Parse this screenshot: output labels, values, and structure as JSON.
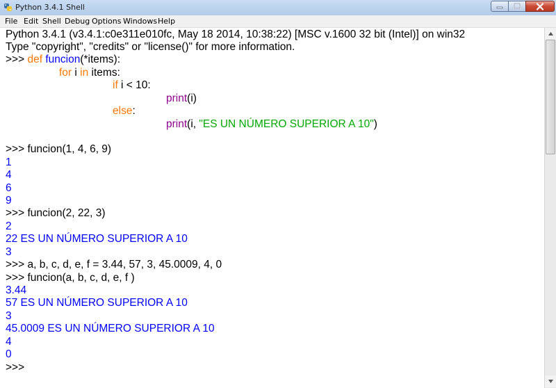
{
  "window": {
    "title": "Python 3.4.1 Shell",
    "app_icon": "python-icon"
  },
  "menu": [
    "File",
    "Edit",
    "Shell",
    "Debug",
    "Options",
    "Windows",
    "Help"
  ],
  "controls": {
    "minimize_icon": "minimize-icon",
    "maximize_icon": "maximize-icon",
    "close_icon": "close-icon"
  },
  "colors": {
    "keyword": "#ff7700",
    "definition": "#0000ff",
    "builtin": "#900090",
    "string": "#00aa00",
    "output": "#0000ff"
  },
  "shell": {
    "banner1": "Python 3.4.1 (v3.4.1:c0e311e010fc, May 18 2014, 10:38:22) [MSC v.1600 32 bit (Intel)] on win32",
    "banner2": "Type \"copyright\", \"credits\" or \"license()\" for more information.",
    "prompt": ">>> ",
    "def_kw": "def",
    "def_name": "funcion",
    "def_rest": "(*items):",
    "for_kw": "for",
    "for_mid": " i ",
    "in_kw": "in",
    "for_rest": " items:",
    "if_kw": "if",
    "if_rest": " i < 10:",
    "print1_fn": "print",
    "print1_rest": "(i)",
    "else_kw": "else",
    "else_rest": ":",
    "print2_fn": "print",
    "print2_mid": "(i, ",
    "print2_str": "\"ES UN NÚMERO SUPERIOR A 10\"",
    "print2_end": ")",
    "cmd1": "funcion(1, 4, 6, 9)",
    "out1": [
      "1",
      "4",
      "6",
      "9"
    ],
    "cmd2": "funcion(2, 22, 3)",
    "out2": [
      "2",
      "22 ES UN NÚMERO SUPERIOR A 10",
      "3"
    ],
    "cmd3": "a, b, c, d, e, f = 3.44, 57, 3, 45.0009, 4, 0",
    "cmd4": "funcion(a, b, c, d, e, f )",
    "out4": [
      "3.44",
      "57 ES UN NÚMERO SUPERIOR A 10",
      "3",
      "45.0009 ES UN NÚMERO SUPERIOR A 10",
      "4",
      "0"
    ],
    "final_prompt": ">>> "
  }
}
